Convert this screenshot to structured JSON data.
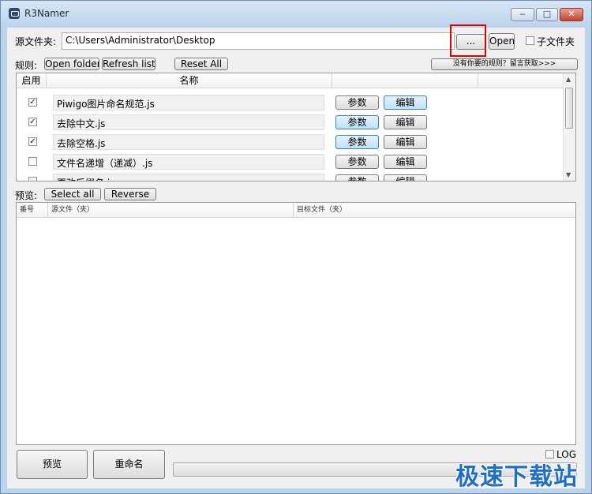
{
  "window": {
    "title": "R3Namer",
    "minimize": "‒",
    "maximize": "□",
    "close": "✕"
  },
  "source": {
    "label": "源文件夹:",
    "path": "C:\\Users\\Administrator\\Desktop",
    "browse_label": "...",
    "open_label": "Open",
    "subfolder_label": "子文件夹",
    "subfolder_checked": false
  },
  "rules": {
    "label": "规则:",
    "open_folder": "Open folder",
    "refresh_list": "Refresh list",
    "reset_all": "Reset All",
    "get_more": "没有你要的规则？留言获取>>>",
    "columns": {
      "enabled": "启用",
      "name": "名称"
    },
    "items": [
      {
        "name": "Piwigo图片命名规范.js",
        "enabled": true,
        "params": "参数",
        "edit": "编辑"
      },
      {
        "name": "去除中文.js",
        "enabled": true,
        "params": "参数",
        "edit": "编辑"
      },
      {
        "name": "去除空格.js",
        "enabled": true,
        "params": "参数",
        "edit": "编辑"
      },
      {
        "name": "文件名递增（递减）.js",
        "enabled": false,
        "params": "参数",
        "edit": "编辑"
      },
      {
        "name": "更改后缀名.js",
        "enabled": false,
        "params": "参数",
        "edit": "编辑"
      }
    ]
  },
  "preview": {
    "label": "预览:",
    "select_all": "Select all",
    "reverse": "Reverse",
    "columns": {
      "index": "番号",
      "source": "源文件（夹）",
      "target": "目标文件（夹）"
    }
  },
  "bottom": {
    "preview_button": "预览",
    "rename_button": "重命名",
    "log_label": "LOG",
    "log_checked": false,
    "progress": 0
  },
  "watermark": "极速下载站",
  "colors": {
    "highlight": "#e00000",
    "watermark": "#1f6fc8"
  }
}
